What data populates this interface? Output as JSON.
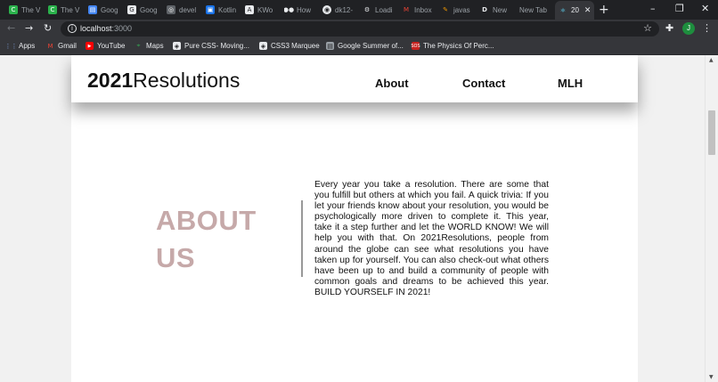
{
  "browser": {
    "tabs": [
      {
        "label": "The V",
        "icon": "c-logo-icon",
        "color": "#2bb24c"
      },
      {
        "label": "The V",
        "icon": "c-logo-icon",
        "color": "#2bb24c"
      },
      {
        "label": "Goog",
        "icon": "docs-icon",
        "color": "#8ab4f8"
      },
      {
        "label": "Goog",
        "icon": "google-icon",
        "color": "#e8eaed"
      },
      {
        "label": "devel",
        "icon": "globe-icon",
        "color": "#9aa0a6"
      },
      {
        "label": "Kotlin",
        "icon": "book-icon",
        "color": "#8ab4f8"
      },
      {
        "label": "KWo",
        "icon": "a-logo-icon",
        "color": "#e8eaed"
      },
      {
        "label": "How",
        "icon": "medium-icon",
        "color": "#e8eaed"
      },
      {
        "label": "dk12-",
        "icon": "github-icon",
        "color": "#e8eaed"
      },
      {
        "label": "Loadi",
        "icon": "gear-icon",
        "color": "#e8eaed"
      },
      {
        "label": "Inbox",
        "icon": "gmail-icon",
        "color": "#ea4335"
      },
      {
        "label": "javas",
        "icon": "pencil-icon",
        "color": "#f29900"
      },
      {
        "label": "New",
        "icon": "d-logo-icon",
        "color": "#e8eaed"
      },
      {
        "label": "New Tab",
        "icon": "",
        "color": "#e8eaed"
      },
      {
        "label": "20",
        "icon": "react-icon",
        "color": "#61dafb"
      }
    ],
    "new_tab": "+",
    "url_host": "localhost",
    "url_port": ":3000",
    "profile_initial": "J",
    "bookmarks": [
      {
        "label": "Apps",
        "icon": "apps-grid-icon"
      },
      {
        "label": "Gmail",
        "icon": "gmail-icon"
      },
      {
        "label": "YouTube",
        "icon": "youtube-icon"
      },
      {
        "label": "Maps",
        "icon": "maps-icon"
      },
      {
        "label": "Pure CSS- Moving...",
        "icon": "codepen-icon"
      },
      {
        "label": "CSS3 Marquee",
        "icon": "codepen-icon"
      },
      {
        "label": "Google Summer of...",
        "icon": "docs-icon"
      },
      {
        "label": "The Physics Of Perc...",
        "icon": "sos-icon"
      }
    ]
  },
  "site": {
    "logo_bold": "2021",
    "logo_light": "Resolutions",
    "nav": [
      "About",
      "Contact",
      "MLH"
    ],
    "about": {
      "heading_line1": "ABOUT",
      "heading_line2": "US",
      "body": "Every year you take a resolution. There are some that you fulfill but others at which you fail. A quick trivia: If you let your friends know about your resolution, you would be psychologically more driven to complete it. This year, take it a step further and let the WORLD KNOW! We will help you with that. On 2021Resolutions, people from around the globe can see what resolutions you have taken up for yourself. You can also check-out what others have been up to and build a community of people with common goals and dreams to be achieved this year. BUILD YOURSELF IN 2021!"
    }
  },
  "colors": {
    "about_heading": "#c6a9a9",
    "browser_dark": "#202124",
    "browser_toolbar": "#35363a"
  }
}
